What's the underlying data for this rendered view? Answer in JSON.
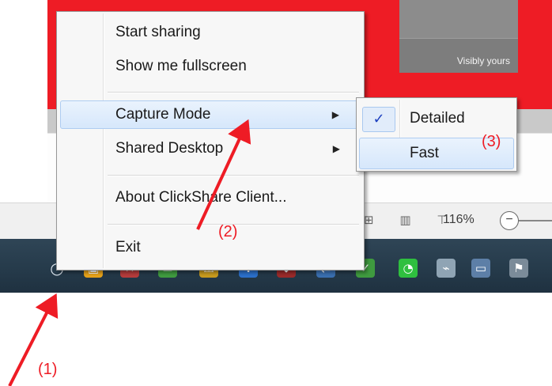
{
  "background": {
    "brand_tagline": "Visibly yours",
    "zoom_level": "116%",
    "zoom_minus": "−",
    "status_icons": "⊞ ▥ ⊤"
  },
  "menu": {
    "items": [
      {
        "label": "Start sharing",
        "has_submenu": false
      },
      {
        "label": "Show me fullscreen",
        "has_submenu": false
      },
      {
        "label": "Capture Mode",
        "has_submenu": true,
        "highlighted": true
      },
      {
        "label": "Shared Desktop",
        "has_submenu": true
      },
      {
        "label": "About ClickShare Client...",
        "has_submenu": false
      },
      {
        "label": "Exit",
        "has_submenu": false
      }
    ],
    "submenu_arrow": "▶"
  },
  "submenu": {
    "items": [
      {
        "label": "Detailed",
        "checked": true
      },
      {
        "label": "Fast",
        "checked": false,
        "highlighted": true
      }
    ],
    "check_glyph": "✓"
  },
  "annotations": {
    "step1": "(1)",
    "step2": "(2)",
    "step3": "(3)",
    "color": "#ee1c25"
  },
  "taskbar": {
    "tray_icons": [
      {
        "name": "clickshare-tray-icon",
        "glyph": "○",
        "color": "transparent"
      },
      {
        "name": "folder-tray-icon",
        "glyph": "▣",
        "color": "#e6a21a"
      },
      {
        "name": "app-error-tray-icon",
        "glyph": "✕",
        "color": "#b63c3c"
      },
      {
        "name": "mail-tray-icon",
        "glyph": "✉",
        "color": "#3f9a3f"
      },
      {
        "name": "warning-tray-icon",
        "glyph": "⚠",
        "color": "#c79a1e"
      },
      {
        "name": "bluetooth-tray-icon",
        "glyph": "✱",
        "color": "#2b6fc9"
      },
      {
        "name": "shield-tray-icon",
        "glyph": "⛊",
        "color": "#9a2a2a"
      },
      {
        "name": "network-tray-icon",
        "glyph": "⇄",
        "color": "#3a6fb0"
      },
      {
        "name": "security-check-tray-icon",
        "glyph": "✓",
        "color": "#3f9a3f"
      },
      {
        "name": "wifi-tray-icon",
        "glyph": "◔",
        "color": "#2fbf3f"
      },
      {
        "name": "power-tray-icon",
        "glyph": "⌁",
        "color": "#8fa4b4"
      },
      {
        "name": "display-tray-icon",
        "glyph": "▭",
        "color": "#5d7fa7"
      },
      {
        "name": "action-center-flag-icon",
        "glyph": "⚑",
        "color": "#7b8b99"
      }
    ]
  }
}
